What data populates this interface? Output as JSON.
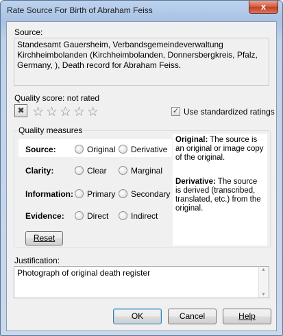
{
  "window": {
    "title": "Rate Source For Birth of Abraham Feiss",
    "close_glyph": "x"
  },
  "source": {
    "label": "Source:",
    "text": "Standesamt Gauersheim, Verbandsgemeindeverwaltung Kirchheimbolanden (Kirchheimbolanden, Donnersbergkreis, Pfalz, Germany, ), Death record for Abraham Feiss."
  },
  "quality": {
    "score_label": "Quality score: not rated",
    "clear_glyph": "✖",
    "stars": [
      "☆",
      "☆",
      "☆",
      "☆",
      "☆"
    ],
    "use_standardized_label": "Use standardized ratings",
    "use_standardized_checked": true,
    "check_glyph": "✓"
  },
  "measures": {
    "caption": "Quality measures",
    "rows": [
      {
        "label": "Source:",
        "opt1": "Original",
        "opt2": "Derivative"
      },
      {
        "label": "Clarity:",
        "opt1": "Clear",
        "opt2": "Marginal"
      },
      {
        "label": "Information:",
        "opt1": "Primary",
        "opt2": "Secondary"
      },
      {
        "label": "Evidence:",
        "opt1": "Direct",
        "opt2": "Indirect"
      }
    ],
    "reset_label": "Reset",
    "help_original_title": "Original:",
    "help_original_text": " The source is an original or image copy of the original.",
    "help_derivative_title": "Derivative:",
    "help_derivative_text": " The source is derived (transcribed, translated, etc.) from the original."
  },
  "justification": {
    "label": "Justification:",
    "text": "Photograph of original  death register",
    "scroll_up": "▲",
    "scroll_down": "▼"
  },
  "buttons": {
    "ok": "OK",
    "cancel": "Cancel",
    "help": "Help"
  }
}
